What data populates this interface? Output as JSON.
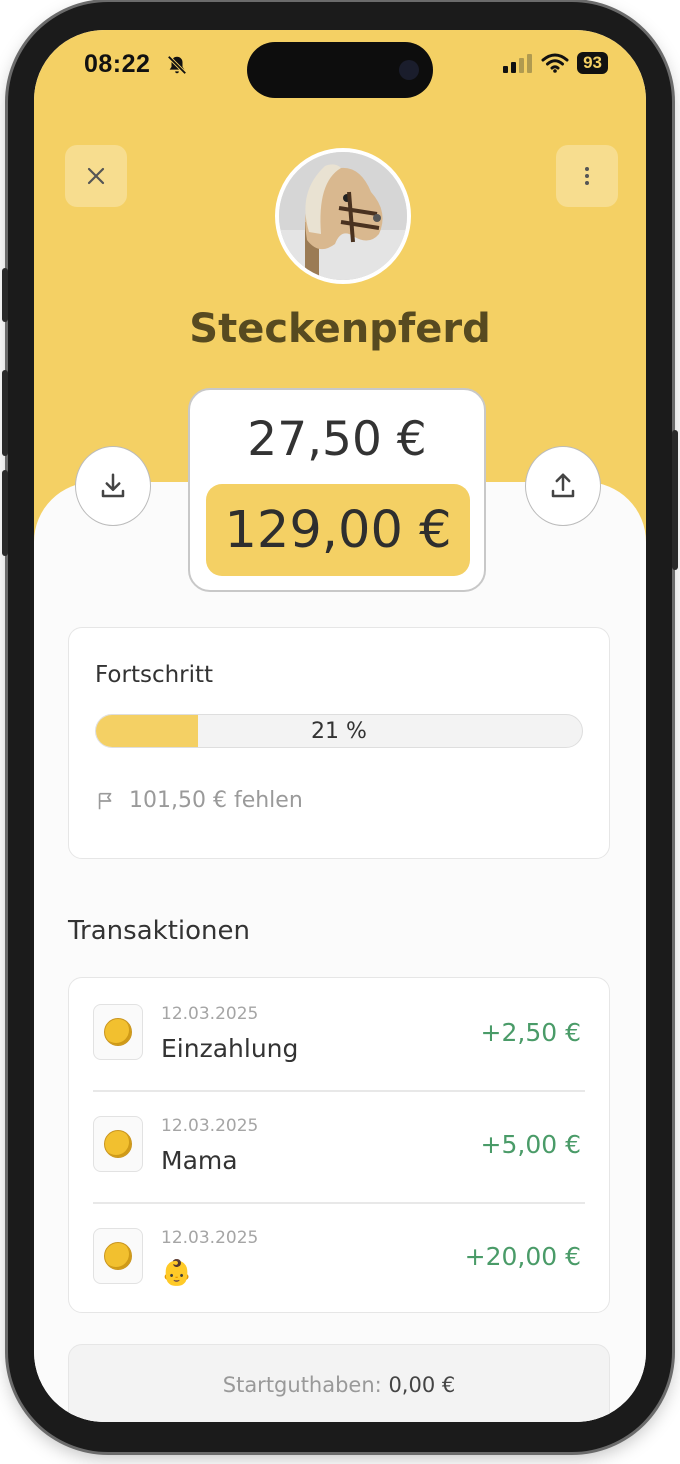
{
  "status_bar": {
    "time": "08:22",
    "battery": "93"
  },
  "header": {
    "title": "Steckenpferd"
  },
  "amounts": {
    "current": "27,50 €",
    "goal": "129,00 €"
  },
  "progress": {
    "label": "Fortschritt",
    "percent_value": 21,
    "percent_text": "21 %",
    "missing_text": "101,50 € fehlen"
  },
  "transactions": {
    "title": "Transaktionen",
    "items": [
      {
        "date": "12.03.2025",
        "name": "Einzahlung",
        "amount": "+2,50 €"
      },
      {
        "date": "12.03.2025",
        "name": "Mama",
        "amount": "+5,00 €"
      },
      {
        "date": "12.03.2025",
        "name": "👶",
        "amount": "+20,00 €"
      }
    ]
  },
  "footer": {
    "start_label": "Startguthaben:",
    "start_value": "0,00 €"
  },
  "colors": {
    "accent": "#f4d064",
    "positive": "#4a9b68",
    "title": "#574a20"
  },
  "icons": [
    "close-icon",
    "more-vertical-icon",
    "download-icon",
    "upload-icon",
    "flag-icon",
    "coin-icon",
    "bell-off-icon",
    "signal-icon",
    "wifi-icon"
  ]
}
